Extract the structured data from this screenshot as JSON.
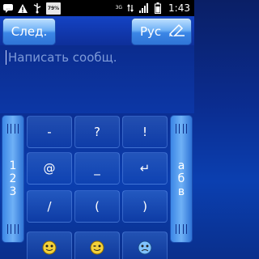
{
  "status_bar": {
    "battery_badge": "79%",
    "network": "3G",
    "time": "1:43"
  },
  "toolbar": {
    "next_label": "След.",
    "lang_label": "Рус"
  },
  "compose": {
    "placeholder": "Написать сообщ."
  },
  "keyboard": {
    "left_label": "1\n2\n3",
    "right_label": "а\nб\nв",
    "keys": [
      "-",
      "?",
      "!",
      "@",
      "_",
      "↵",
      "/",
      "(",
      ")"
    ]
  }
}
